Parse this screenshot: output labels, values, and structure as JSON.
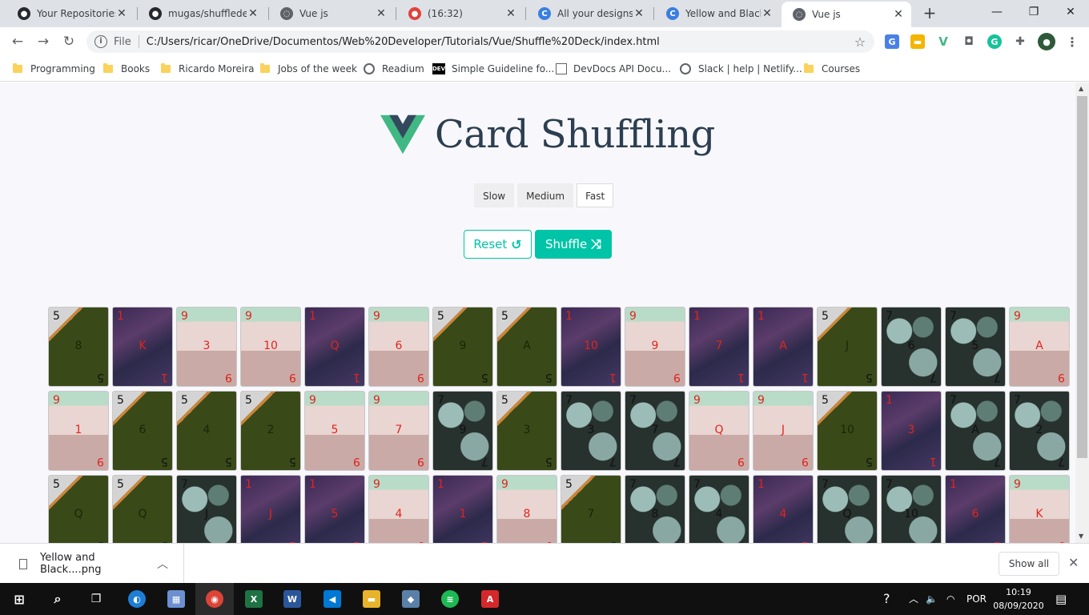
{
  "tabs": [
    {
      "title": "Your Repositories",
      "icon": "github-icon",
      "active": false
    },
    {
      "title": "mugas/shuffledeck",
      "icon": "github-icon",
      "active": false
    },
    {
      "title": "Vue js",
      "icon": "globe-icon",
      "active": false
    },
    {
      "title": "(16:32)",
      "icon": "tomato-icon",
      "active": false
    },
    {
      "title": "All your designs -",
      "icon": "canva-icon",
      "active": false
    },
    {
      "title": "Yellow and Black C",
      "icon": "canva-icon",
      "active": false
    },
    {
      "title": "Vue js",
      "icon": "globe-icon",
      "active": true
    }
  ],
  "toolbar": {
    "file_label": "File",
    "url": "C:/Users/ricar/OneDrive/Documentos/Web%20Developer/Tutorials/Vue/Shuffle%20Deck/index.html"
  },
  "bookmarks": [
    {
      "label": "Programming",
      "icon": "folder-icon"
    },
    {
      "label": "Books",
      "icon": "folder-icon"
    },
    {
      "label": "Ricardo Moreira",
      "icon": "folder-icon"
    },
    {
      "label": "Jobs of the week",
      "icon": "folder-icon"
    },
    {
      "label": "Readium",
      "icon": "globe-icon"
    },
    {
      "label": "Simple Guideline fo...",
      "icon": "dev-icon"
    },
    {
      "label": "DevDocs API Docu...",
      "icon": "search-icon"
    },
    {
      "label": "Slack | help | Netlify...",
      "icon": "globe-icon"
    },
    {
      "label": "Courses",
      "icon": "folder-icon"
    }
  ],
  "app": {
    "title": "Card Shuffling",
    "speeds": [
      {
        "label": "Slow",
        "selected": false
      },
      {
        "label": "Medium",
        "selected": false
      },
      {
        "label": "Fast",
        "selected": true
      }
    ],
    "reset_label": "Reset",
    "shuffle_label": "Shuffle",
    "accent_color": "#00c4a7"
  },
  "cards": [
    [
      {
        "suit": "leaf",
        "corner": "5",
        "value": "8"
      },
      {
        "suit": "galaxy",
        "corner": "1",
        "value": "K"
      },
      {
        "suit": "scale",
        "corner": "9",
        "value": "3"
      },
      {
        "suit": "scale",
        "corner": "9",
        "value": "10"
      },
      {
        "suit": "galaxy",
        "corner": "1",
        "value": "Q"
      },
      {
        "suit": "scale",
        "corner": "9",
        "value": "6"
      },
      {
        "suit": "leaf",
        "corner": "5",
        "value": "9"
      },
      {
        "suit": "leaf",
        "corner": "5",
        "value": "A"
      },
      {
        "suit": "galaxy",
        "corner": "1",
        "value": "10"
      },
      {
        "suit": "scale",
        "corner": "9",
        "value": "9"
      },
      {
        "suit": "galaxy",
        "corner": "1",
        "value": "7"
      },
      {
        "suit": "galaxy",
        "corner": "1",
        "value": "A"
      },
      {
        "suit": "leaf",
        "corner": "5",
        "value": "J"
      },
      {
        "suit": "succulent",
        "corner": "7",
        "value": "6"
      },
      {
        "suit": "succulent",
        "corner": "7",
        "value": "5"
      },
      {
        "suit": "scale",
        "corner": "9",
        "value": "A"
      }
    ],
    [
      {
        "suit": "scale",
        "corner": "9",
        "value": "1"
      },
      {
        "suit": "leaf",
        "corner": "5",
        "value": "6"
      },
      {
        "suit": "leaf",
        "corner": "5",
        "value": "4"
      },
      {
        "suit": "leaf",
        "corner": "5",
        "value": "2"
      },
      {
        "suit": "scale",
        "corner": "9",
        "value": "5"
      },
      {
        "suit": "scale",
        "corner": "9",
        "value": "7"
      },
      {
        "suit": "succulent",
        "corner": "7",
        "value": "9"
      },
      {
        "suit": "leaf",
        "corner": "5",
        "value": "3"
      },
      {
        "suit": "succulent",
        "corner": "7",
        "value": "3"
      },
      {
        "suit": "succulent",
        "corner": "7",
        "value": "7"
      },
      {
        "suit": "scale",
        "corner": "9",
        "value": "Q"
      },
      {
        "suit": "scale",
        "corner": "9",
        "value": "J"
      },
      {
        "suit": "leaf",
        "corner": "5",
        "value": "10"
      },
      {
        "suit": "galaxy",
        "corner": "1",
        "value": "3"
      },
      {
        "suit": "succulent",
        "corner": "7",
        "value": "A"
      },
      {
        "suit": "succulent",
        "corner": "7",
        "value": "2"
      }
    ],
    [
      {
        "suit": "leaf",
        "corner": "5",
        "value": "Q"
      },
      {
        "suit": "leaf",
        "corner": "5",
        "value": "Q"
      },
      {
        "suit": "succulent",
        "corner": "7",
        "value": "J"
      },
      {
        "suit": "galaxy",
        "corner": "1",
        "value": "J"
      },
      {
        "suit": "galaxy",
        "corner": "1",
        "value": "5"
      },
      {
        "suit": "scale",
        "corner": "9",
        "value": "4"
      },
      {
        "suit": "galaxy",
        "corner": "1",
        "value": "1"
      },
      {
        "suit": "scale",
        "corner": "9",
        "value": "8"
      },
      {
        "suit": "leaf",
        "corner": "5",
        "value": "7"
      },
      {
        "suit": "succulent",
        "corner": "7",
        "value": "8"
      },
      {
        "suit": "succulent",
        "corner": "7",
        "value": "4"
      },
      {
        "suit": "galaxy",
        "corner": "1",
        "value": "4"
      },
      {
        "suit": "succulent",
        "corner": "7",
        "value": "Q"
      },
      {
        "suit": "succulent",
        "corner": "7",
        "value": "10"
      },
      {
        "suit": "galaxy",
        "corner": "1",
        "value": "6"
      },
      {
        "suit": "scale",
        "corner": "9",
        "value": "K"
      }
    ]
  ],
  "downloads": {
    "file_name": "Yellow and Black....png",
    "show_all_label": "Show all"
  },
  "taskbar": {
    "lang": "POR",
    "time": "10:19",
    "date": "08/09/2020"
  }
}
